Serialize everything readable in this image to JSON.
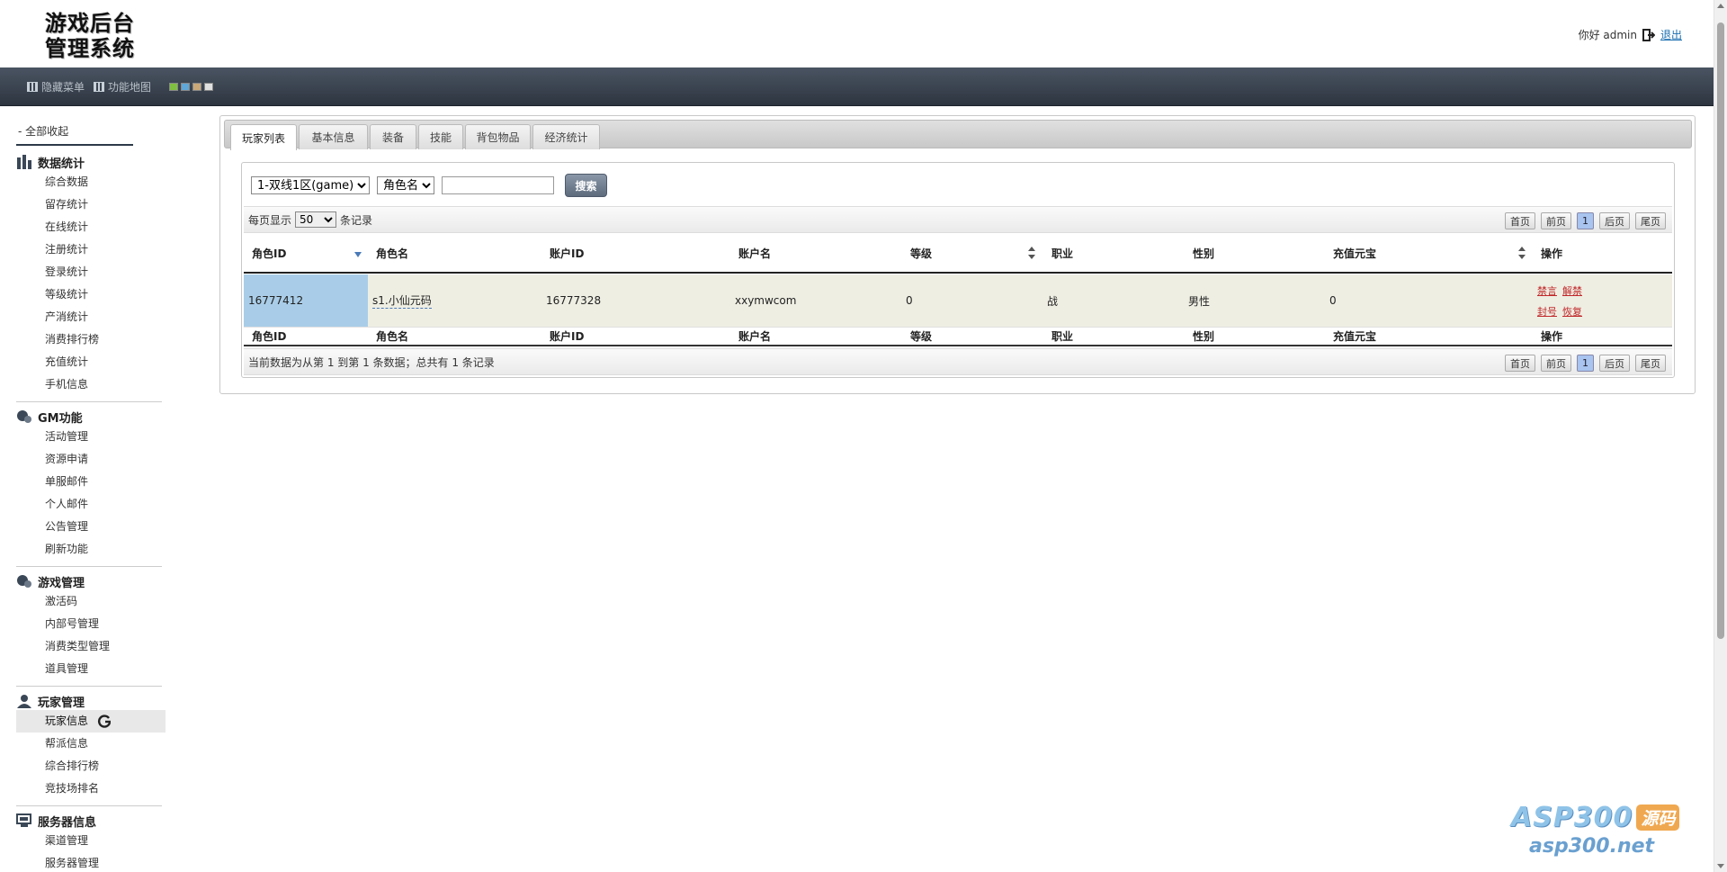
{
  "header": {
    "logo_line1": "游戏后台",
    "logo_line2": "管理系统",
    "greeting": "你好 admin",
    "logout": "退出"
  },
  "toolbar": {
    "hide_menu": "隐藏菜单",
    "function_map": "功能地图",
    "skin_colors": [
      "#7fbf3f",
      "#5fa8d8",
      "#c8a878",
      "#e0e0e0"
    ]
  },
  "sidebar": {
    "collapse_all": "- 全部收起",
    "groups": [
      {
        "title": "数据统计",
        "icon": "bar-chart-icon",
        "items": [
          "综合数据",
          "留存统计",
          "在线统计",
          "注册统计",
          "登录统计",
          "等级统计",
          "产消统计",
          "消费排行榜",
          "充值统计",
          "手机信息"
        ]
      },
      {
        "title": "GM功能",
        "icon": "bubbles-icon",
        "items": [
          "活动管理",
          "资源申请",
          "单服邮件",
          "个人邮件",
          "公告管理",
          "刷新功能"
        ]
      },
      {
        "title": "游戏管理",
        "icon": "bubbles-icon",
        "items": [
          "激活码",
          "内部号管理",
          "消费类型管理",
          "道具管理"
        ]
      },
      {
        "title": "玩家管理",
        "icon": "user-icon",
        "items": [
          "玩家信息",
          "帮派信息",
          "综合排行榜",
          "竞技场排名"
        ]
      },
      {
        "title": "服务器信息",
        "icon": "server-icon",
        "items": [
          "渠道管理",
          "服务器管理"
        ]
      }
    ]
  },
  "tabs": [
    "玩家列表",
    "基本信息",
    "装备",
    "技能",
    "背包物品",
    "经济统计"
  ],
  "search": {
    "server_value": "1-双线1区(game)",
    "field_value": "角色名",
    "keyword": "",
    "button": "搜索"
  },
  "list_bar": {
    "per_page_prefix": "每页显示",
    "per_page_value": "50",
    "per_page_suffix": "条记录"
  },
  "pager": {
    "first": "首页",
    "prev": "前页",
    "current": "1",
    "next": "后页",
    "last": "尾页"
  },
  "table": {
    "columns": [
      "角色ID",
      "角色名",
      "账户ID",
      "账户名",
      "等级",
      "职业",
      "性别",
      "充值元宝",
      "操作"
    ],
    "rows": [
      {
        "role_id": "16777412",
        "role_name": "s1.小仙元码",
        "account_id": "16777328",
        "account_name": "xxymwcom",
        "level": "0",
        "job": "战",
        "gender": "男性",
        "recharge": "0",
        "ops": [
          "禁言",
          "解禁",
          "封号",
          "恢复"
        ]
      }
    ]
  },
  "footer_info": "当前数据为从第 1 到第 1 条数据；总共有 1 条记录",
  "watermark": {
    "brand": "ASP300",
    "badge": "源码",
    "site": "asp300.net"
  }
}
